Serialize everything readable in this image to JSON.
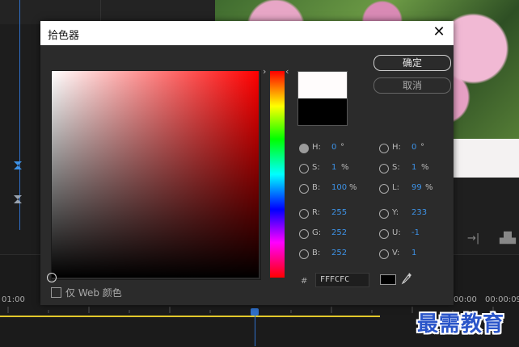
{
  "dialog": {
    "title": "拾色器",
    "ok_label": "确定",
    "cancel_label": "取消",
    "web_only_label": "仅 Web 颜色",
    "hex_prefix": "#",
    "hex_value": "FFFCFC"
  },
  "fields": {
    "left": [
      {
        "label": "H:",
        "value": "0",
        "unit": "°",
        "selected": true
      },
      {
        "label": "S:",
        "value": "1",
        "unit": "%",
        "selected": false
      },
      {
        "label": "B:",
        "value": "100",
        "unit": "%",
        "selected": false
      },
      {
        "label": "R:",
        "value": "255",
        "unit": "",
        "selected": false
      },
      {
        "label": "G:",
        "value": "252",
        "unit": "",
        "selected": false
      },
      {
        "label": "B:",
        "value": "252",
        "unit": "",
        "selected": false
      }
    ],
    "right": [
      {
        "label": "H:",
        "value": "0",
        "unit": "°",
        "selected": false
      },
      {
        "label": "S:",
        "value": "1",
        "unit": "%",
        "selected": false
      },
      {
        "label": "L:",
        "value": "99",
        "unit": "%",
        "selected": false
      },
      {
        "label": "Y:",
        "value": "233",
        "unit": "",
        "selected": false
      },
      {
        "label": "U:",
        "value": "-1",
        "unit": "",
        "selected": false
      },
      {
        "label": "V:",
        "value": "1",
        "unit": "",
        "selected": false
      }
    ]
  },
  "colors": {
    "new_color": "#fffcfc",
    "old_color": "#000000",
    "accent": "#3d92e6"
  },
  "timeline": {
    "time_left": "01:00",
    "time_right_a": "00:00",
    "time_right_b": "00:00:09"
  },
  "watermark": "最需教育"
}
